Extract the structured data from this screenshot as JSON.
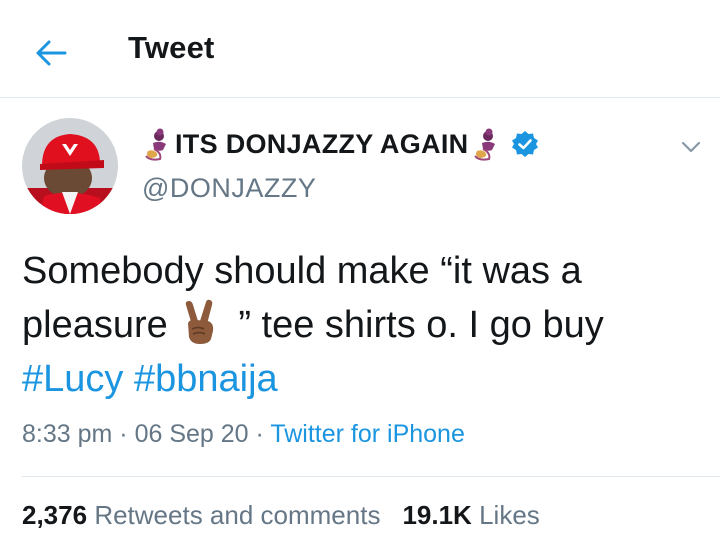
{
  "header": {
    "title": "Tweet",
    "back_icon": "arrow-left-icon"
  },
  "author": {
    "display_name": "ITS DONJAZZY AGAIN",
    "handle": "@DONJAZZY",
    "verified": true,
    "name_decoration_icon": "genie-emoji"
  },
  "tweet": {
    "text_line1": "Somebody should make “it was a",
    "text_part2a": "pleasure",
    "emoji_icon": "victory-hand-emoji",
    "text_part2b": " ” tee shirts o. I go buy",
    "hashtag1": "#Lucy",
    "hashtag2": "#bbnaija"
  },
  "meta": {
    "time": "8:33 pm",
    "separator": " · ",
    "date": "06 Sep 20",
    "source": "Twitter for iPhone"
  },
  "stats": {
    "retweets_count": "2,376",
    "retweets_label": "Retweets and comments",
    "likes_count": "19.1K",
    "likes_label": "Likes"
  },
  "colors": {
    "accent": "#1b95e0",
    "text": "#14171a",
    "secondary": "#657786",
    "divider": "#e1e8ed"
  }
}
